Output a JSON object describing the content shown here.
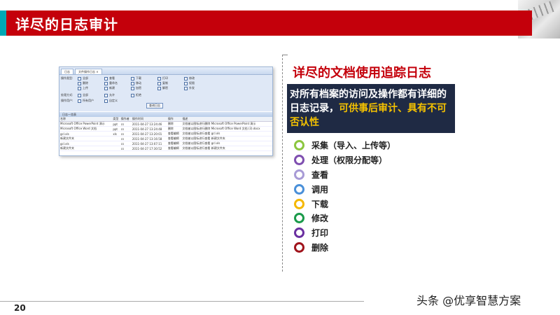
{
  "slide": {
    "title": "详尽的日志审计",
    "page_number": "20",
    "watermark": "头条 @优享智慧方案"
  },
  "screenshot": {
    "tabs": [
      "日志",
      "文件操作日志 ×"
    ],
    "form_rows": [
      {
        "label": "操作类型:",
        "options": [
          "全部",
          "查看",
          "下载",
          "打印",
          "修改"
        ]
      },
      {
        "label": "",
        "options": [
          "删除",
          "重命名",
          "移动",
          "复制",
          "权限"
        ]
      },
      {
        "label": "",
        "options": [
          "上传",
          "新建",
          "加密",
          "解密",
          "外发"
        ]
      },
      {
        "label": "处理方式:",
        "options": [
          "全部",
          "允许",
          "拒绝"
        ]
      },
      {
        "label": "操作用户:",
        "options": [
          "所有用户",
          "自定义"
        ]
      }
    ],
    "query_button": "查询日志",
    "grid_title": "日志一览表",
    "columns": [
      "名称",
      "类型",
      "操作者",
      "操作时间",
      "操作",
      "描述"
    ],
    "rows": [
      [
        "Microsoft Office PowerPoint 演示",
        "ppt",
        "cs",
        "2011-04-27 13:24:46",
        "删除",
        "文档被以图标进行删除 Microsoft Office PowerPoint 演示"
      ],
      [
        "Microsoft Office Word 文档",
        "ppt",
        "cs",
        "2011-04-27 13:24:48",
        "删除",
        "文档被以图标进行删除 Microsoft Office Word 文档 (3).docx"
      ],
      [
        "gcl.xls",
        "xls",
        "cs",
        "2011-04-27 13:20:01",
        "查看编辑",
        "文档被以图标进行查看 gcl.xls"
      ],
      [
        "新建文件夹",
        "",
        "cs",
        "2011-04-27 13:16:58",
        "查看编辑",
        "文档被以图标进行查看 新建文件夹"
      ],
      [
        "gcl.xls",
        "",
        "cs",
        "2011-04-27 13:07:11",
        "查看编辑",
        "文档被以图标进行查看 gcl.xls"
      ],
      [
        "新建文件夹",
        "",
        "cs",
        "2011-04-27 17:30:52",
        "查看编辑",
        "文档被以图标进行查看 新建文件夹"
      ]
    ]
  },
  "right": {
    "title": "详尽的文档使用追踪日志",
    "desc_lines": [
      {
        "text": "对所有档案的访问及操作都有详细的",
        "highlight": ""
      },
      {
        "text": "日志记录，",
        "highlight": "可供事后审计、具有不可"
      },
      {
        "text": "",
        "highlight": "否认性"
      }
    ],
    "items": [
      {
        "label": "采集（导入、上传等）",
        "color": "#8cc63f"
      },
      {
        "label": "处理（权限分配等）",
        "color": "#7f4fb0"
      },
      {
        "label": "查看",
        "color": "#a89bd6"
      },
      {
        "label": "调用",
        "color": "#4a90d9"
      },
      {
        "label": "下载",
        "color": "#f5b800"
      },
      {
        "label": "修改",
        "color": "#1a9a4a"
      },
      {
        "label": "打印",
        "color": "#6a2fa0"
      },
      {
        "label": "删除",
        "color": "#a0141c"
      }
    ]
  }
}
